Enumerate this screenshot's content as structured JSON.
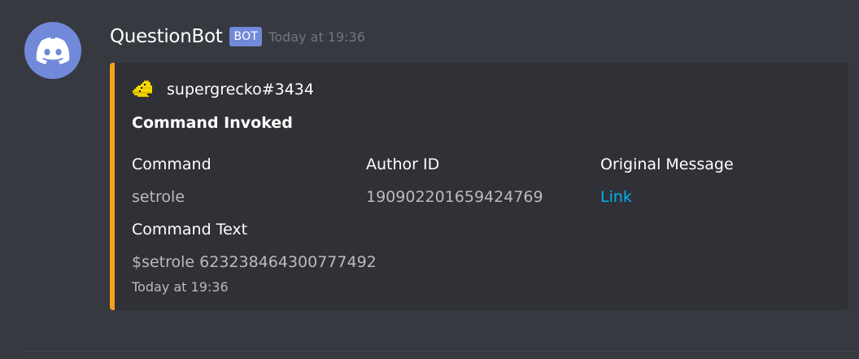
{
  "message": {
    "username": "QuestionBot",
    "badge": "BOT",
    "timestamp": "Today at 19:36",
    "avatar_icon": "discord-logo-icon",
    "avatar_color": "#7289da"
  },
  "embed": {
    "accent_color": "#f8a01b",
    "author": {
      "name": "supergrecko#3434",
      "icon": "pixel-avatar-icon"
    },
    "title": "Command Invoked",
    "fields": [
      {
        "name": "Command",
        "value": "setrole"
      },
      {
        "name": "Author ID",
        "value": "190902201659424769"
      },
      {
        "name": "Original Message",
        "value": "Link"
      },
      {
        "name": "Command Text",
        "value": "$setrole 623238464300777492"
      }
    ],
    "footer": "Today at 19:36"
  }
}
